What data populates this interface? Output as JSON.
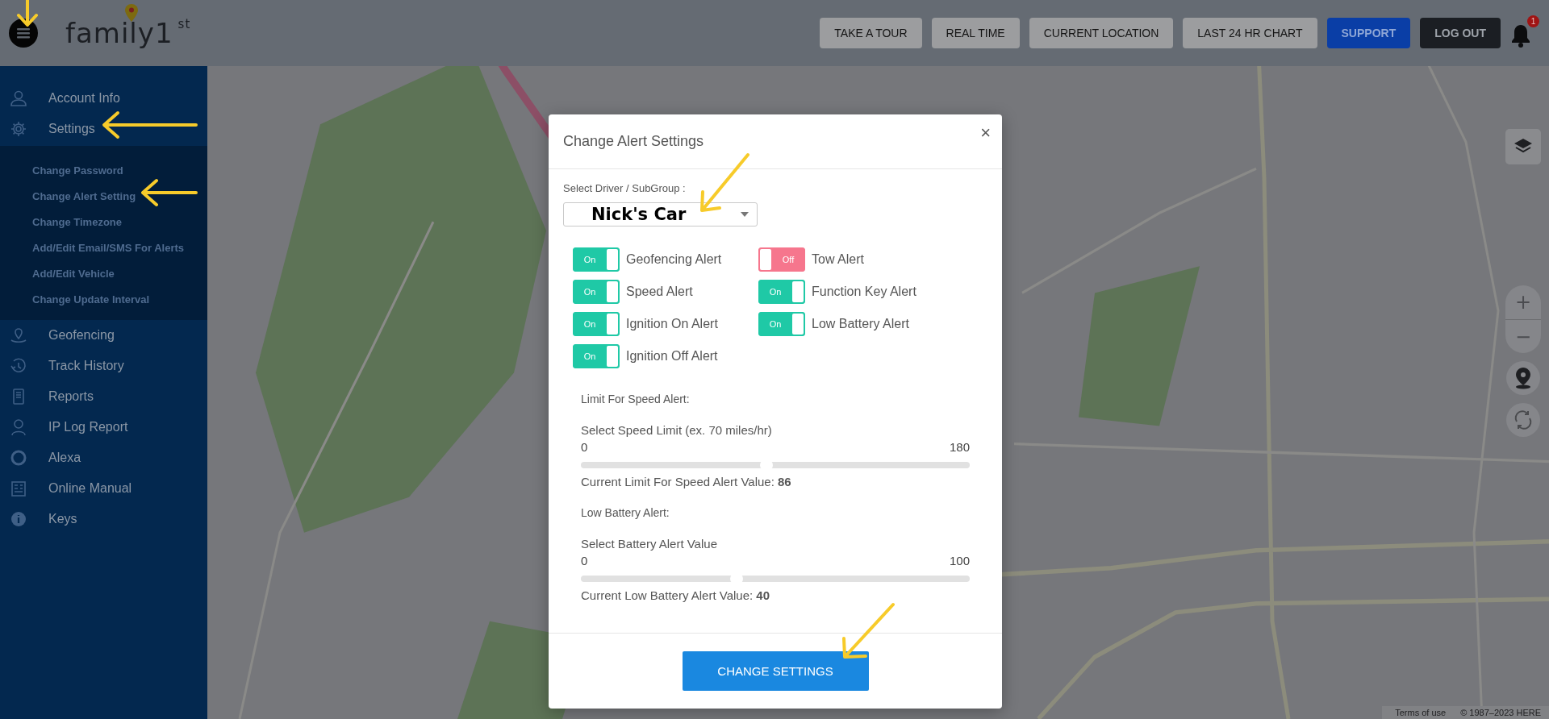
{
  "header": {
    "logo": "family1$^{st}$",
    "buttons": [
      {
        "label": "TAKE A TOUR",
        "kind": "plain"
      },
      {
        "label": "REAL TIME",
        "kind": "plain"
      },
      {
        "label": "CURRENT LOCATION",
        "kind": "plain"
      },
      {
        "label": "LAST 24 HR CHART",
        "kind": "plain"
      },
      {
        "label": "SUPPORT",
        "kind": "primary"
      },
      {
        "label": "LOG OUT",
        "kind": "dark"
      }
    ],
    "notification_count": "1"
  },
  "sidebar": {
    "items": [
      {
        "label": "Account Info"
      },
      {
        "label": "Settings",
        "expanded": true,
        "children": [
          {
            "label": "Change Password"
          },
          {
            "label": "Change Alert Setting"
          },
          {
            "label": "Change Timezone"
          },
          {
            "label": "Add/Edit Email/SMS For Alerts"
          },
          {
            "label": "Add/Edit Vehicle"
          },
          {
            "label": "Change Update Interval"
          }
        ]
      },
      {
        "label": "Geofencing"
      },
      {
        "label": "Track History"
      },
      {
        "label": "Reports"
      },
      {
        "label": "IP Log Report"
      },
      {
        "label": "Alexa"
      },
      {
        "label": "Online Manual"
      },
      {
        "label": "Keys"
      }
    ]
  },
  "map": {
    "kind": "picture",
    "attribution": {
      "terms": "Terms of use",
      "copyright": "© 1987–2023 HERE"
    },
    "zoom_in": "+",
    "zoom_out": "−"
  },
  "dialog": {
    "title": "Change Alert Settings",
    "close": "×",
    "driver_label": "Select Driver / SubGroup :",
    "driver_value": "Nick's Car",
    "alerts": [
      {
        "label": "Geofencing Alert",
        "on": true,
        "toggle_text": "On"
      },
      {
        "label": "Tow Alert",
        "on": false,
        "toggle_text": "Off"
      },
      {
        "label": "Speed Alert",
        "on": true,
        "toggle_text": "On"
      },
      {
        "label": "Function Key Alert",
        "on": true,
        "toggle_text": "On"
      },
      {
        "label": "Ignition On Alert",
        "on": true,
        "toggle_text": "On"
      },
      {
        "label": "Low Battery Alert",
        "on": true,
        "toggle_text": "On"
      },
      {
        "label": "Ignition Off Alert",
        "on": true,
        "toggle_text": "On"
      }
    ],
    "sliders": [
      {
        "heading": "Limit For Speed Alert:",
        "label": "Select Speed Limit (ex. 70 miles/hr)",
        "min": "0",
        "max": "180",
        "level": 0.478,
        "current": "Current Limit For Speed Alert Value: **86**"
      },
      {
        "heading": "Low Battery Alert:",
        "label": "Select Battery Alert Value",
        "min": "0",
        "max": "100",
        "level": 0.4,
        "current": "Current Low Battery Alert Value: **40**"
      }
    ],
    "submit": "CHANGE SETTINGS"
  }
}
